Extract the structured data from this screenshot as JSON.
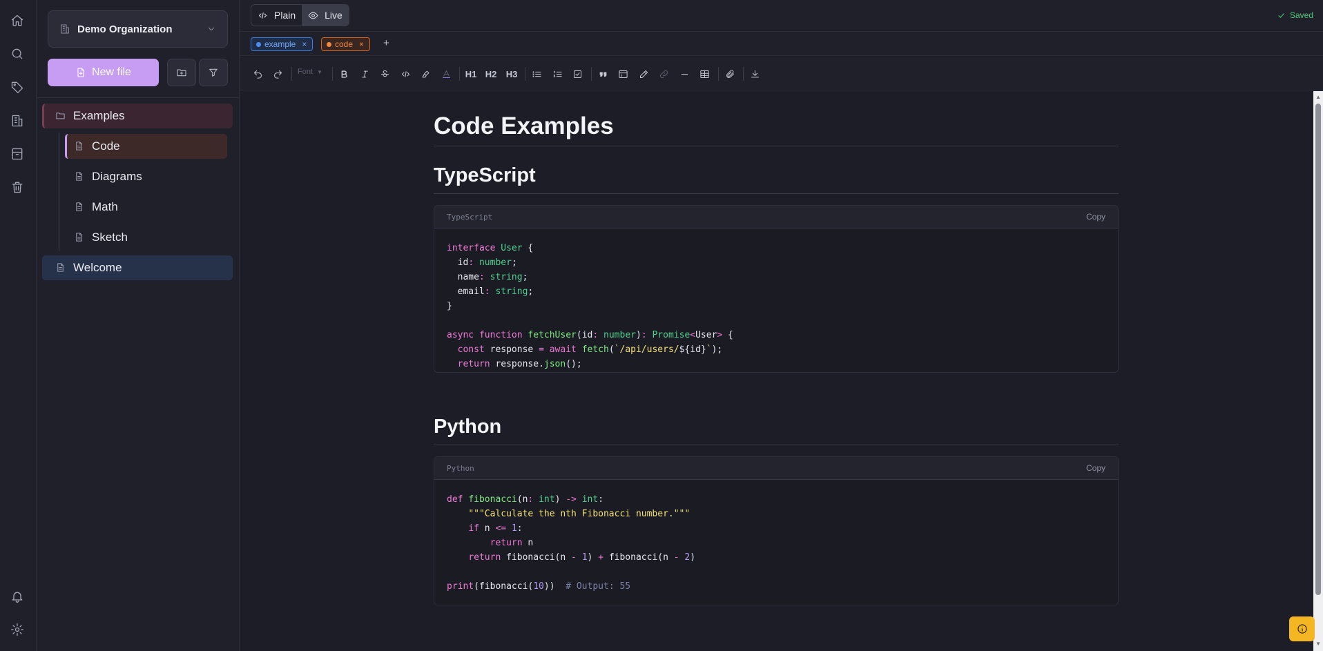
{
  "sidebar": {
    "org_name": "Demo Organization",
    "new_file_label": "New file",
    "tree": {
      "folder": "Examples",
      "children": [
        "Code",
        "Diagrams",
        "Math",
        "Sketch"
      ],
      "root_file": "Welcome"
    }
  },
  "topbar": {
    "plain_label": "Plain",
    "live_label": "Live",
    "status": "Saved"
  },
  "tags": [
    {
      "label": "example",
      "color": "#4b8df5"
    },
    {
      "label": "code",
      "color": "#f2893f"
    }
  ],
  "toolbar": {
    "font_label": "Font",
    "h1": "H1",
    "h2": "H2",
    "h3": "H3"
  },
  "doc": {
    "title": "Code Examples",
    "sections": [
      {
        "heading": "TypeScript",
        "lang": "TypeScript",
        "copy": "Copy"
      },
      {
        "heading": "Python",
        "lang": "Python",
        "copy": "Copy"
      }
    ]
  },
  "colors": {
    "accent": "#c79cf3",
    "saved": "#4ccb7a",
    "info_button": "#f5b623"
  }
}
